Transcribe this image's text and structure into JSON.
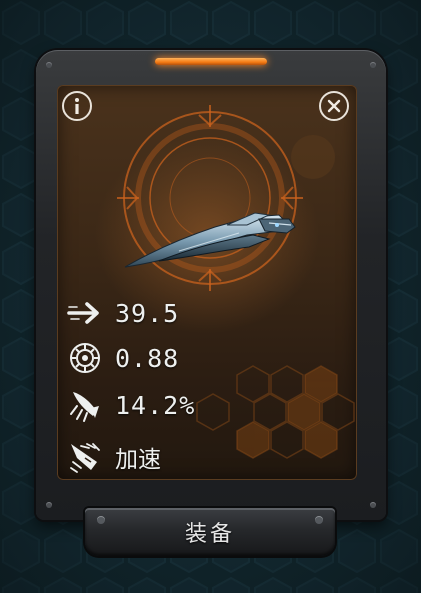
{
  "colors": {
    "accent_orange": "#f47a14",
    "panel_brown": "#3a2716",
    "frame_dark": "#222427",
    "backdrop": "#11242a",
    "ship_steel": "#8fb3c9"
  },
  "header": {
    "info_icon": "info-icon",
    "close_icon": "close-icon"
  },
  "item": {
    "image": "spaceship-weapon-icon",
    "reticle": "targeting-reticle-icon"
  },
  "stats": [
    {
      "icon": "arrow-right-icon",
      "value": "39.5"
    },
    {
      "icon": "gear-burst-icon",
      "value": "0.88"
    },
    {
      "icon": "rocket-icon",
      "value": "14.2%"
    },
    {
      "icon": "thruster-icon",
      "value": "加速"
    }
  ],
  "footer": {
    "equip_label": "装备"
  }
}
